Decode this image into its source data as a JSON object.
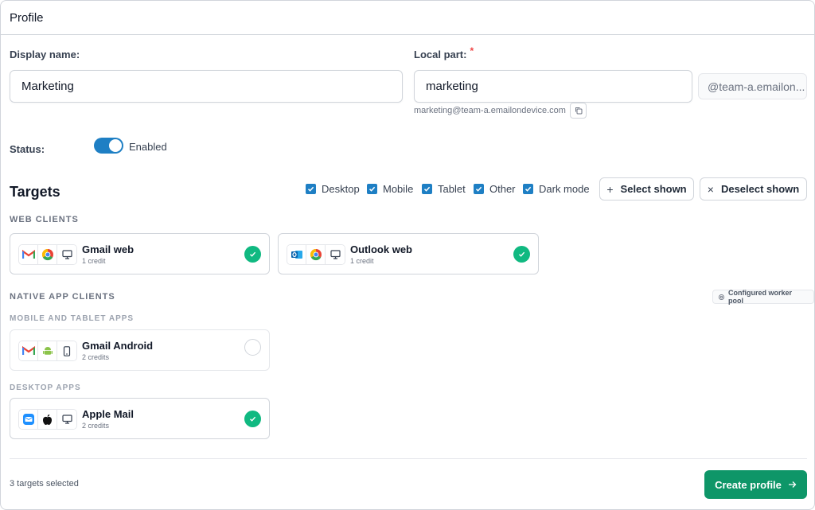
{
  "header": {
    "title": "Profile"
  },
  "form": {
    "display_name_label": "Display name:",
    "display_name_value": "Marketing",
    "local_part_label": "Local part:",
    "required_marker": "*",
    "local_part_value": "marketing",
    "domain_suffix": "@team-a.emailon...",
    "full_address": "marketing@team-a.emailondevice.com",
    "status_label": "Status:",
    "status_value": "Enabled",
    "status_enabled": true
  },
  "targets": {
    "title": "Targets",
    "filters": [
      {
        "label": "Desktop",
        "checked": true
      },
      {
        "label": "Mobile",
        "checked": true
      },
      {
        "label": "Tablet",
        "checked": true
      },
      {
        "label": "Other",
        "checked": true
      },
      {
        "label": "Dark mode",
        "checked": true
      }
    ],
    "select_shown_label": "Select shown",
    "deselect_shown_label": "Deselect shown"
  },
  "web_clients": {
    "heading": "WEB CLIENTS",
    "items": [
      {
        "name": "Gmail web",
        "credits": "1 credit",
        "selected": true,
        "icons": [
          "gmail-icon",
          "chrome-icon",
          "desktop-icon"
        ]
      },
      {
        "name": "Outlook web",
        "credits": "1 credit",
        "selected": true,
        "icons": [
          "outlook-icon",
          "chrome-icon",
          "desktop-icon"
        ]
      }
    ]
  },
  "native_clients": {
    "heading": "NATIVE APP CLIENTS",
    "badge": "Configured worker pool",
    "mobile_heading": "MOBILE AND TABLET APPS",
    "mobile_items": [
      {
        "name": "Gmail Android",
        "credits": "2 credits",
        "selected": false,
        "icons": [
          "gmail-icon",
          "android-icon",
          "phone-icon"
        ]
      }
    ],
    "desktop_heading": "DESKTOP APPS",
    "desktop_items": [
      {
        "name": "Apple Mail",
        "credits": "2 credits",
        "selected": true,
        "icons": [
          "apple-mail-icon",
          "apple-icon",
          "desktop-icon"
        ]
      }
    ]
  },
  "footer": {
    "selected_count_text": "3 targets selected",
    "create_label": "Create profile"
  },
  "colors": {
    "accent": "#1e7fc4",
    "success": "#10b981",
    "primary_button": "#0e9668"
  }
}
